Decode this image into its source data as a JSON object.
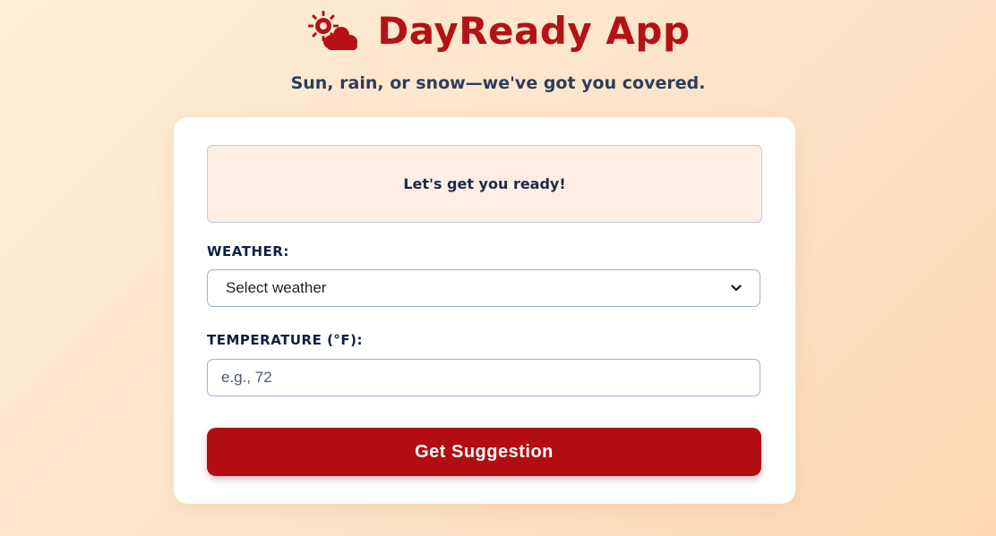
{
  "header": {
    "app_title": "DayReady App",
    "logo_icon": "sun-cloud-icon",
    "subtitle": "Sun, rain, or snow—we've got you covered."
  },
  "card": {
    "message": "Let's get you ready!",
    "weather_label": "WEATHER:",
    "weather_select_value": "Select weather",
    "temperature_label": "TEMPERATURE (°F):",
    "temperature_placeholder": "e.g., 72",
    "submit_label": "Get Suggestion"
  },
  "colors": {
    "brand": "#b41217",
    "button": "#b30d14",
    "message_bg": "#fdeee6",
    "text_dark": "#0f1f45"
  }
}
